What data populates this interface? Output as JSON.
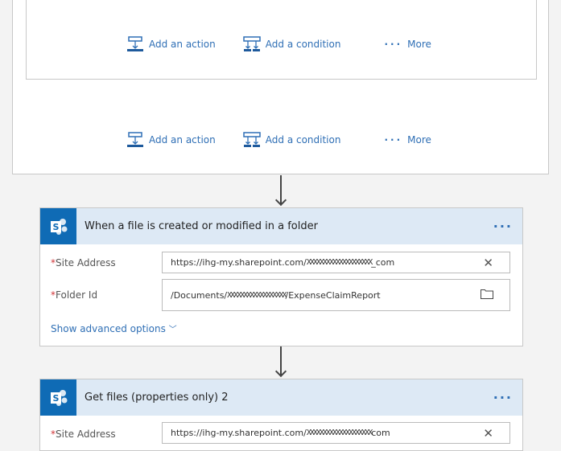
{
  "action_bar": {
    "add_action": "Add an action",
    "add_condition": "Add a condition",
    "more": "More"
  },
  "cards": [
    {
      "title": "When a file is created or modified in a folder",
      "menu": "···",
      "fields": [
        {
          "label": "Site Address",
          "prefix": "https://ihg-my.sharepoint.com/",
          "redacted": "XXXXXXXXXXXXXXXXXXXX",
          "suffix": "_com",
          "icon": "clear-icon"
        },
        {
          "label": "Folder Id",
          "prefix": "/Documents/",
          "redacted": "XXXXXXXXXXXXXXXXXX",
          "suffix": "/ExpenseClaimReport",
          "icon": "folder-icon"
        }
      ],
      "advanced": "Show advanced options"
    },
    {
      "title": "Get files (properties only) 2",
      "menu": "···",
      "fields": [
        {
          "label": "Site Address",
          "prefix": "https://ihg-my.sharepoint.com/",
          "redacted": "XXXXXXXXXXXXXXXXXXXX",
          "suffix": "com",
          "icon": "clear-icon"
        }
      ]
    }
  ],
  "colors": {
    "accent": "#2f6fb5",
    "sharepoint": "#0f6bb5",
    "header": "#dde9f5",
    "required": "#d13438"
  }
}
